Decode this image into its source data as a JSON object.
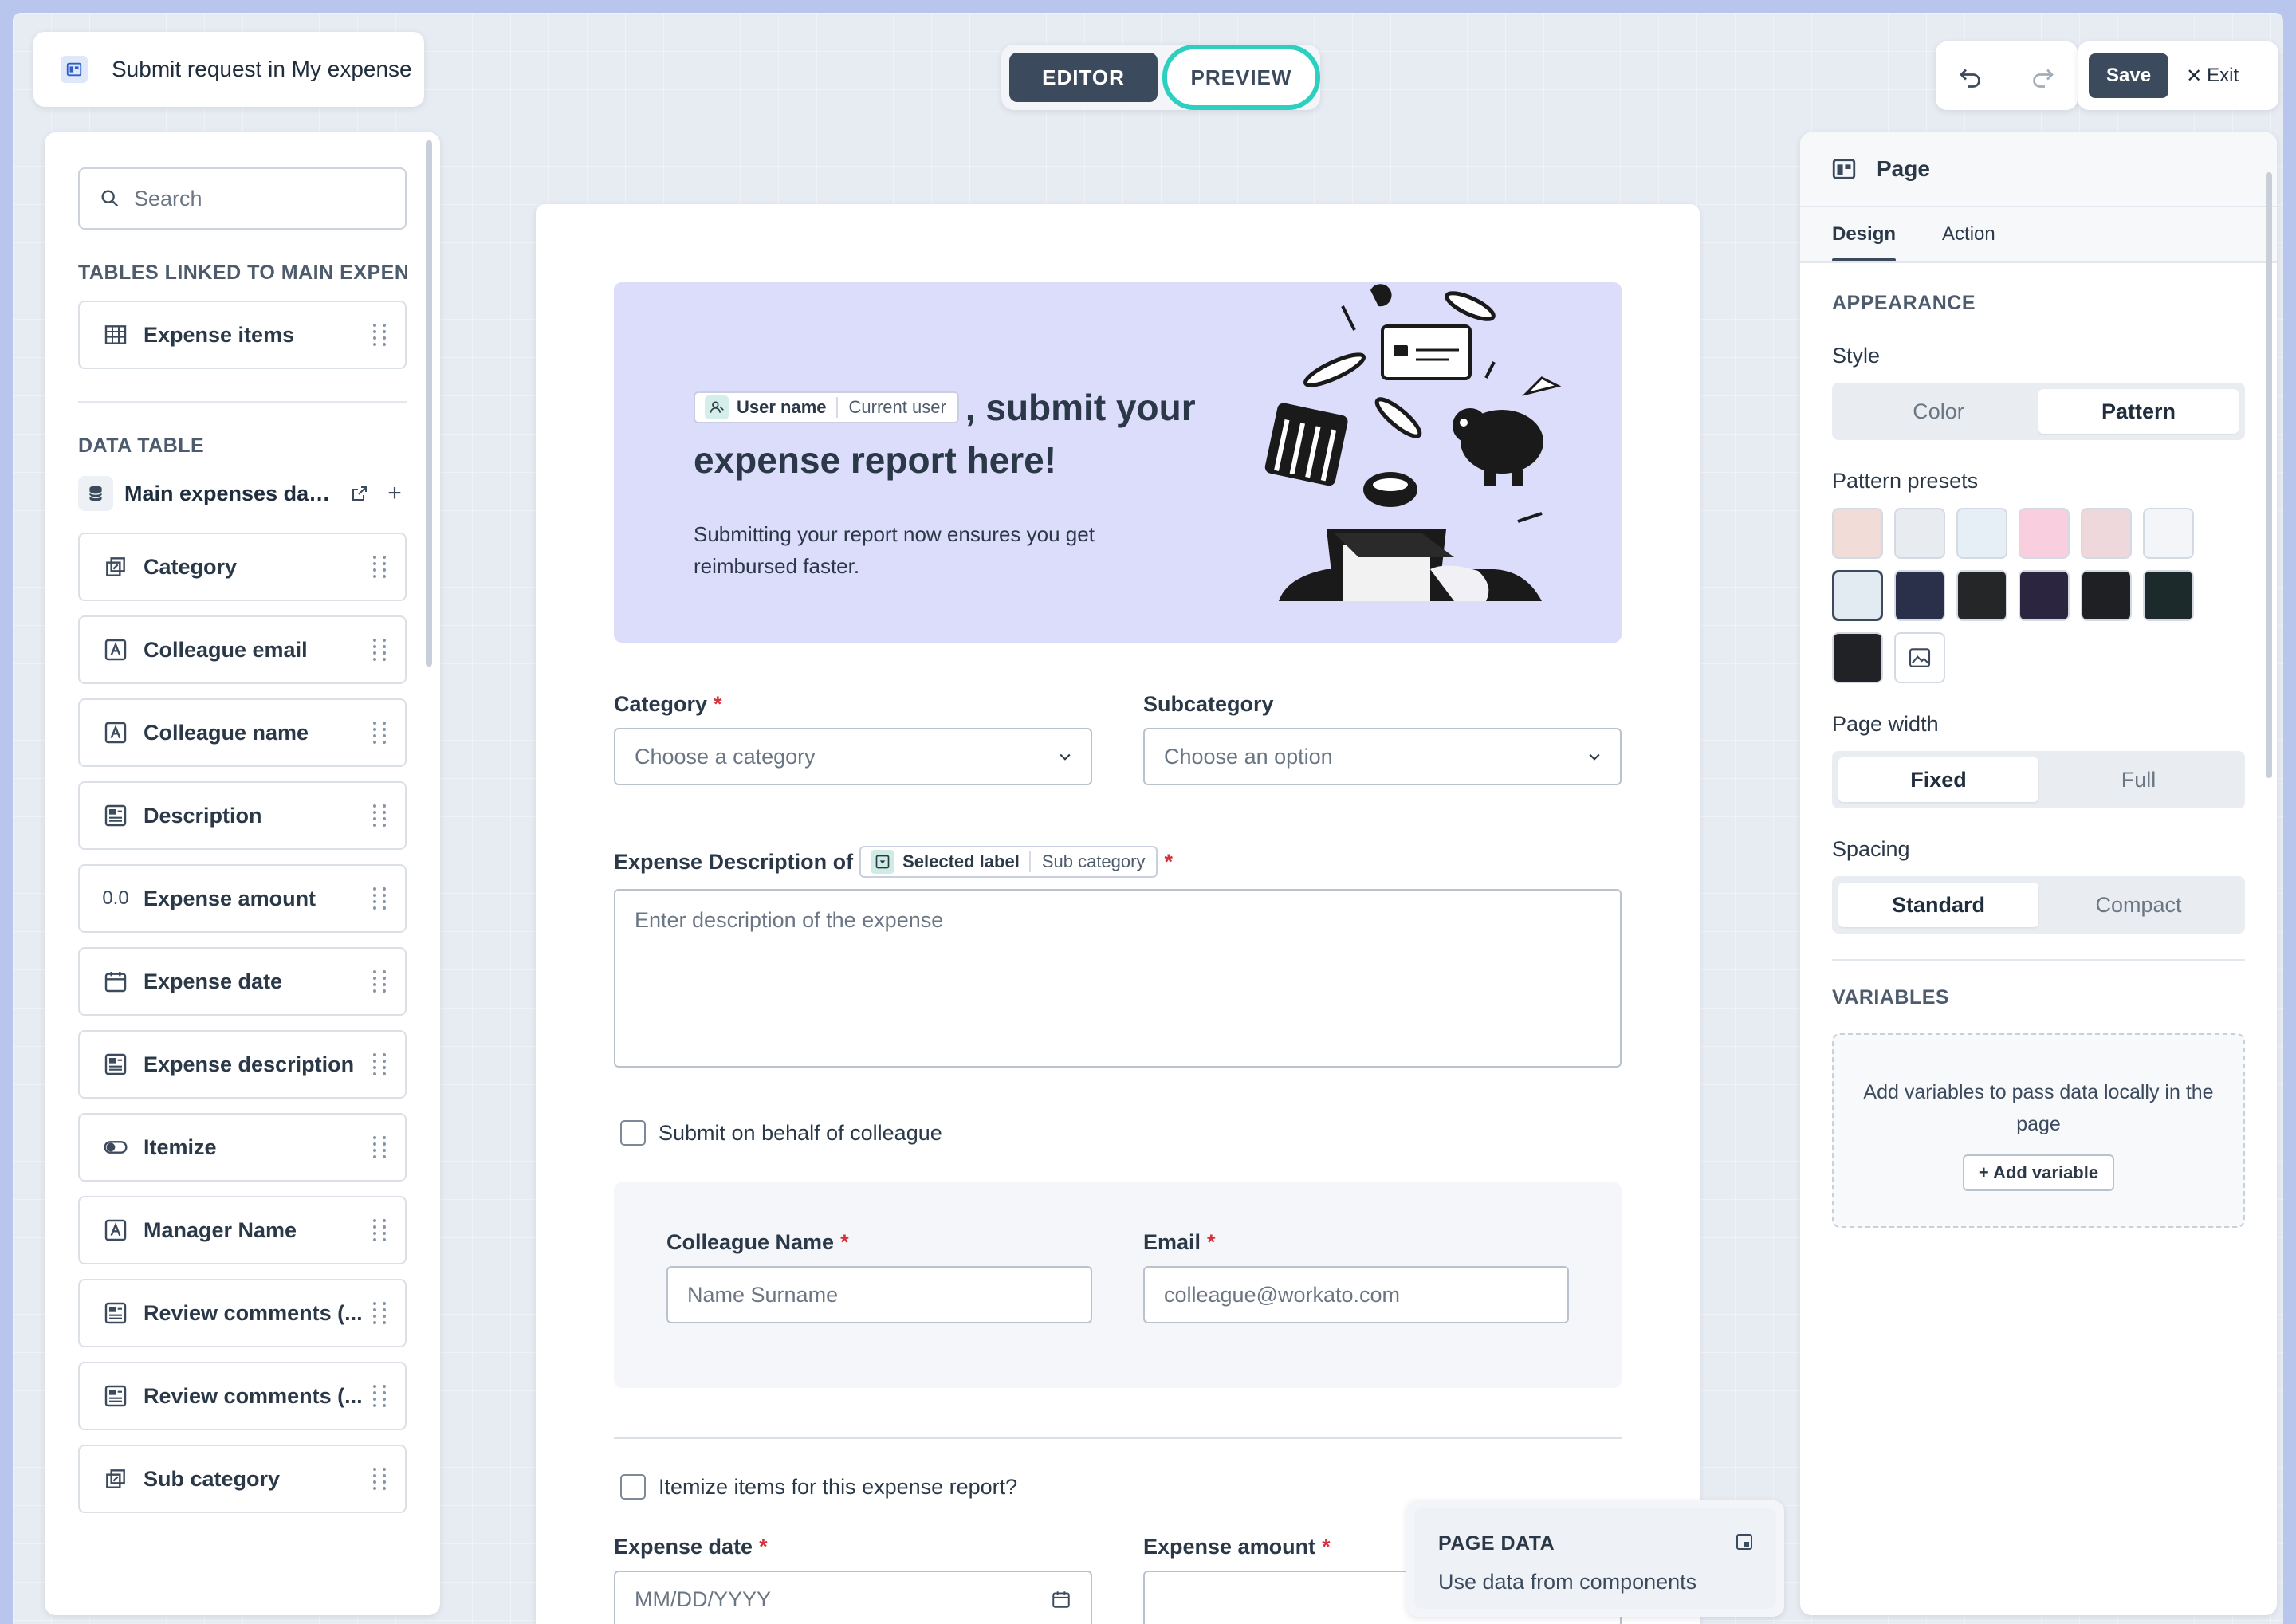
{
  "app": {
    "title": "Submit request in My expense",
    "modes": {
      "editor": "EDITOR",
      "preview": "PREVIEW",
      "active": "editor",
      "highlighted": "preview"
    },
    "save_label": "Save",
    "exit_label": "Exit"
  },
  "sidebar": {
    "search_placeholder": "Search",
    "linked_section_title": "TABLES LINKED TO MAIN EXPEN...",
    "linked_tables": [
      {
        "label": "Expense items",
        "icon": "table-icon"
      }
    ],
    "data_table_title": "DATA TABLE",
    "data_source_label": "Main expenses data ...",
    "fields": [
      {
        "label": "Category",
        "icon": "lookup-icon"
      },
      {
        "label": "Colleague email",
        "icon": "text-field-icon"
      },
      {
        "label": "Colleague name",
        "icon": "text-field-icon"
      },
      {
        "label": "Description",
        "icon": "long-text-icon"
      },
      {
        "label": "Expense amount",
        "icon": "decimal-icon",
        "icon_text": "0.0"
      },
      {
        "label": "Expense date",
        "icon": "calendar-icon"
      },
      {
        "label": "Expense description",
        "icon": "long-text-icon"
      },
      {
        "label": "Itemize",
        "icon": "toggle-icon"
      },
      {
        "label": "Manager Name",
        "icon": "text-field-icon"
      },
      {
        "label": "Review comments (...",
        "icon": "long-text-icon"
      },
      {
        "label": "Review comments (...",
        "icon": "long-text-icon"
      },
      {
        "label": "Sub category",
        "icon": "lookup-icon"
      }
    ]
  },
  "canvas": {
    "banner": {
      "chip_label": "User name",
      "chip_source": "Current user",
      "headline_suffix": ", submit your",
      "headline_line2": "expense report here!",
      "subtitle": "Submitting your report now ensures you get reimbursed faster."
    },
    "category": {
      "label": "Category",
      "placeholder": "Choose a category",
      "required": "*"
    },
    "subcategory": {
      "label": "Subcategory",
      "placeholder": "Choose an option"
    },
    "description": {
      "label": "Expense Description of",
      "chip_label": "Selected label",
      "chip_source": "Sub category",
      "required": "*",
      "placeholder": "Enter description of the expense"
    },
    "behalf_checkbox": {
      "label": "Submit on behalf of colleague",
      "checked": false
    },
    "colleague": {
      "name_label": "Colleague Name",
      "name_placeholder": "Name Surname",
      "email_label": "Email",
      "email_placeholder": "colleague@workato.com",
      "required": "*"
    },
    "itemize_checkbox": {
      "label": "Itemize items for this expense report?",
      "checked": false
    },
    "expense_date": {
      "label": "Expense date",
      "placeholder": "MM/DD/YYYY",
      "required": "*"
    },
    "expense_amount": {
      "label": "Expense amount",
      "required": "*"
    }
  },
  "page_data_panel": {
    "title": "PAGE DATA",
    "subtitle": "Use data from components"
  },
  "right_panel": {
    "title": "Page",
    "tabs": [
      "Design",
      "Action"
    ],
    "active_tab": "Design",
    "appearance_title": "APPEARANCE",
    "style_label": "Style",
    "style_options": [
      "Color",
      "Pattern"
    ],
    "style_selected": "Pattern",
    "presets_label": "Pattern presets",
    "presets": [
      {
        "name": "blush-pattern",
        "color": "#f2dcd8"
      },
      {
        "name": "grid-pattern",
        "color": "#e8ebf0"
      },
      {
        "name": "dots-pattern",
        "color": "#e6eef6"
      },
      {
        "name": "pink-pattern",
        "color": "#f9cfe0"
      },
      {
        "name": "rose-pattern",
        "color": "#efd8dc"
      },
      {
        "name": "light-arrow-pattern",
        "color": "#f3f5f8"
      },
      {
        "name": "pale-blue-pattern",
        "color": "#e2eaf2"
      },
      {
        "name": "navy-arc-pattern",
        "color": "#2a2f4a"
      },
      {
        "name": "black-pattern",
        "color": "#242628"
      },
      {
        "name": "purple-pattern",
        "color": "#2b2540"
      },
      {
        "name": "dark-grid-pattern",
        "color": "#1e2024"
      },
      {
        "name": "teal-dark-pattern",
        "color": "#1c2a2c"
      },
      {
        "name": "dark-arrow-pattern",
        "color": "#202225"
      },
      {
        "name": "image-upload",
        "color": "#ffffff"
      }
    ],
    "presets_selected_index": 6,
    "width_label": "Page width",
    "width_options": [
      "Fixed",
      "Full"
    ],
    "width_selected": "Fixed",
    "spacing_label": "Spacing",
    "spacing_options": [
      "Standard",
      "Compact"
    ],
    "spacing_selected": "Standard",
    "variables_title": "VARIABLES",
    "variables_text": "Add variables to pass data locally in the page",
    "add_variable_label": "+ Add variable"
  }
}
